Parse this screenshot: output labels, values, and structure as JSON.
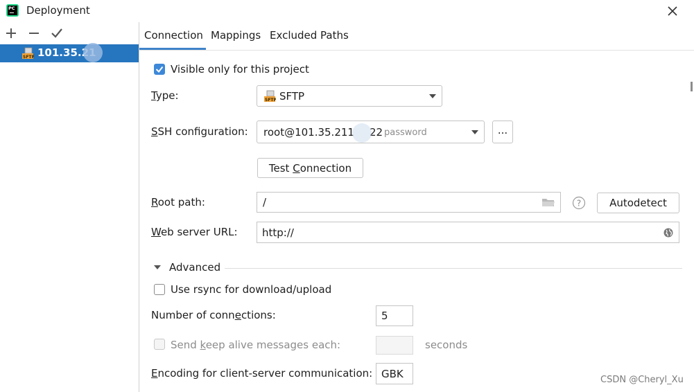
{
  "window": {
    "title": "Deployment"
  },
  "left_panel": {
    "server": {
      "label": "101.35.21",
      "icon": "sftp-server-icon"
    }
  },
  "tabs": [
    {
      "label": "Connection",
      "active": true
    },
    {
      "label": "Mappings",
      "active": false
    },
    {
      "label": "Excluded Paths",
      "active": false
    }
  ],
  "connection": {
    "visible_only": {
      "label": "Visible only for this project",
      "checked": true
    },
    "type": {
      "label_underlined": "T",
      "label_rest": "ype:",
      "value": "SFTP"
    },
    "ssh": {
      "label_underlined": "S",
      "label_rest": "SH configuration:",
      "value_host": "root@101.35.211",
      "value_port": "22",
      "value_auth": "password",
      "more_label": "..."
    },
    "test_connection": {
      "label_pre": "Test ",
      "label_underlined": "C",
      "label_post": "onnection"
    },
    "root_path": {
      "label_underlined": "R",
      "label_rest": "oot path:",
      "value": "/",
      "autodetect_label": "Autodetect",
      "help_symbol": "?"
    },
    "web_url": {
      "label_underlined": "W",
      "label_rest": "eb server URL:",
      "value": "http://"
    },
    "advanced": {
      "label": "Advanced",
      "rsync": {
        "label": "Use rsync for download/upload",
        "checked": false
      },
      "connections": {
        "label_pre": "Number of conn",
        "label_underlined": "e",
        "label_post": "ctions:",
        "value": "5"
      },
      "keepalive": {
        "label_pre": "Send ",
        "label_underlined": "k",
        "label_post": "eep alive messages each:",
        "value": "",
        "unit": "seconds",
        "enabled": false
      },
      "encoding": {
        "label_underlined": "E",
        "label_rest": "ncoding for client-server communication:",
        "value": "GBK"
      }
    }
  },
  "watermark": "CSDN @Cheryl_Xu",
  "colors": {
    "selection": "#2675bf",
    "accent": "#4083c9",
    "checkbox": "#3d88d8"
  }
}
